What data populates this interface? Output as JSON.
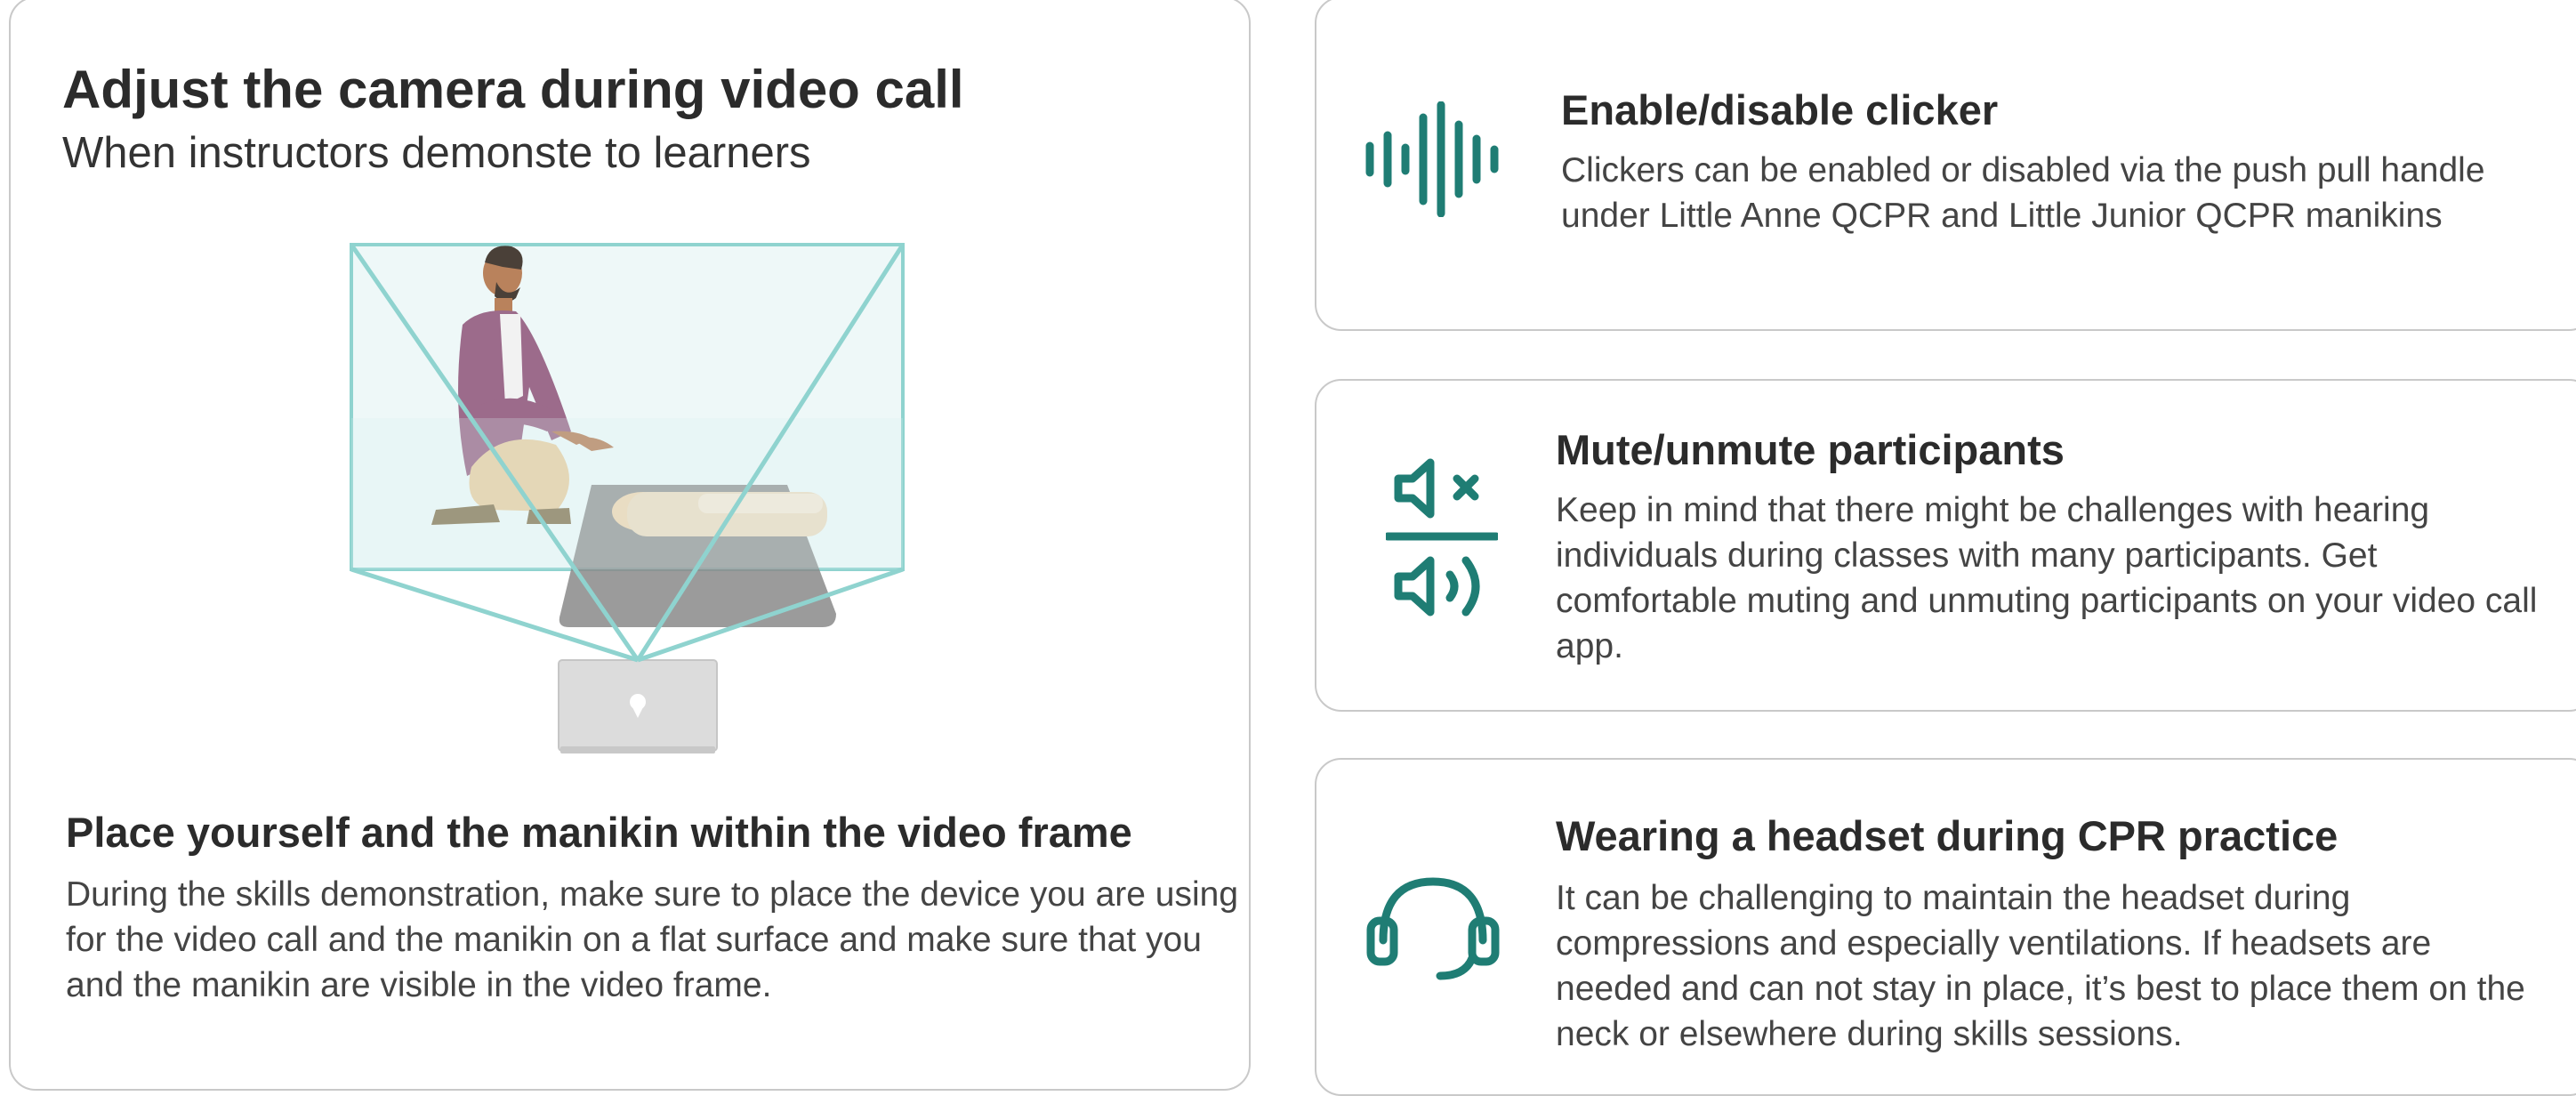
{
  "left_panel": {
    "title": "Adjust the camera during video call",
    "subtitle": "When instructors demonste to learners",
    "section_title": "Place yourself and the manikin within the video frame",
    "section_body": "During the skills demonstration, make sure to place the device you are using for the video call and the manikin on a flat surface and make sure that you and the manikin are visible in the video frame.",
    "illustration": "instructor-kneeling-beside-manikin-with-laptop-camera-view"
  },
  "features": [
    {
      "icon": "sound-wave-icon",
      "title": "Enable/disable clicker",
      "body": "Clickers can be enabled or disabled via the push pull handle under Little Anne QCPR and Little Junior QCPR  manikins"
    },
    {
      "icon": "mute-unmute-icon",
      "title": "Mute/unmute participants",
      "body": "Keep in mind that there might be challenges with hearing individuals during classes with many participants. Get comfortable muting and unmuting participants on your video call app."
    },
    {
      "icon": "headset-icon",
      "title": "Wearing a headset during CPR practice",
      "body": "It can be challenging to maintain the headset during compressions and especially ventilations. If headsets are needed and can not stay in place, it’s best to place them on the neck or elsewhere during skills sessions."
    }
  ],
  "colors": {
    "accent": "#1f7d74",
    "card_border": "#c9c9c9",
    "frame_line": "#8fd3cf"
  }
}
